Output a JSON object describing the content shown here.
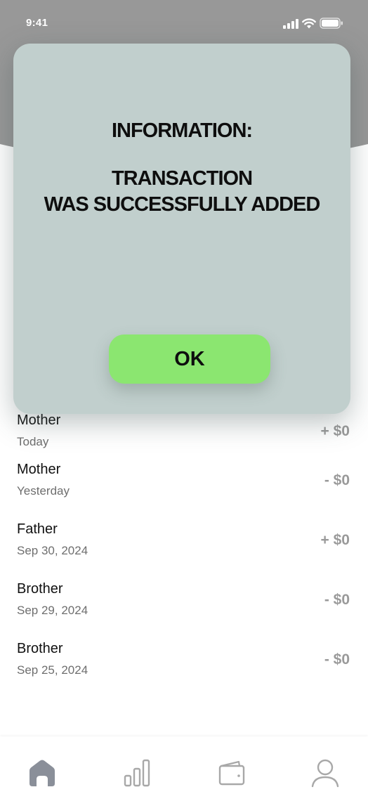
{
  "status_bar": {
    "time": "9:41"
  },
  "modal": {
    "heading": "INFORMATION:",
    "message": "TRANSACTION\nWAS SUCCESSFULLY ADDED",
    "ok_label": "OK"
  },
  "transactions": [
    {
      "name": "Mother",
      "date": "Today",
      "amount": "+ $0"
    },
    {
      "name": "Mother",
      "date": "Yesterday",
      "amount": "- $0"
    },
    {
      "name": "Father",
      "date": "Sep 30, 2024",
      "amount": "+ $0"
    },
    {
      "name": "Brother",
      "date": "Sep 29, 2024",
      "amount": "- $0"
    },
    {
      "name": "Brother",
      "date": "Sep 25, 2024",
      "amount": "- $0"
    }
  ],
  "tab_bar": {
    "items": [
      {
        "icon": "home-icon",
        "active": true
      },
      {
        "icon": "chart-icon",
        "active": false
      },
      {
        "icon": "wallet-icon",
        "active": false
      },
      {
        "icon": "profile-icon",
        "active": false
      }
    ]
  },
  "colors": {
    "header": "#989898",
    "modal_bg": "#c1cfcd",
    "ok_button": "#8be670",
    "amount_text": "#9a9a9a",
    "active_tab": "#8a8f99",
    "inactive_tab": "#a8a8a8"
  }
}
